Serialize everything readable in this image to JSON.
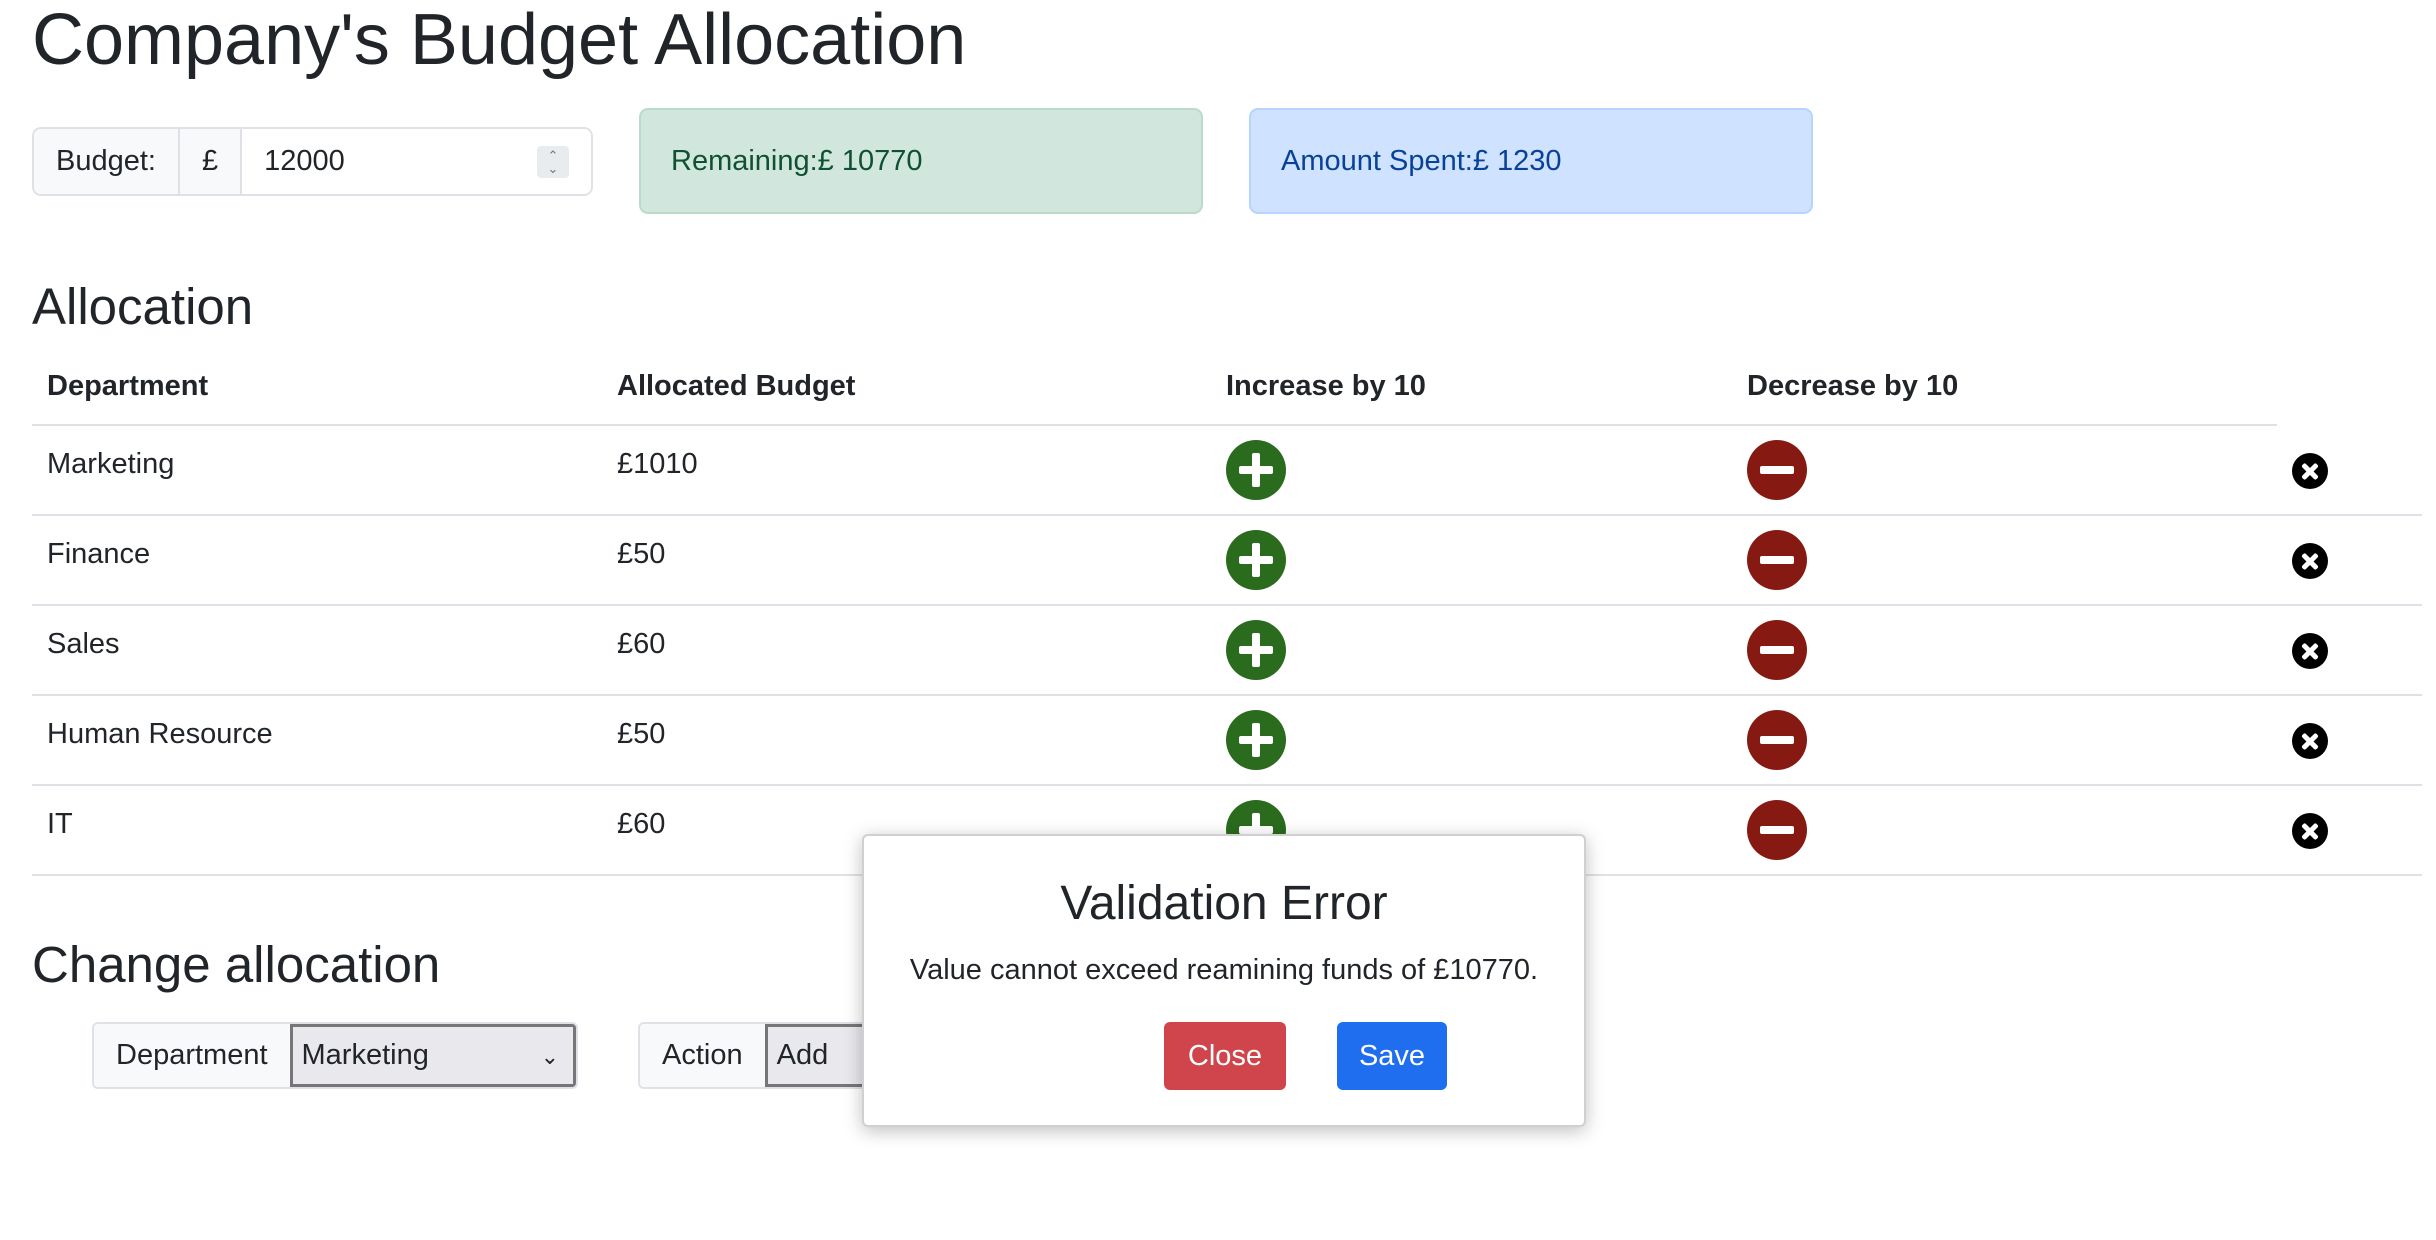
{
  "page": {
    "title": "Company's Budget Allocation"
  },
  "budget": {
    "label": "Budget:",
    "currency": "£",
    "value": "12000"
  },
  "remaining": {
    "text": "Remaining:£ 10770"
  },
  "spent": {
    "text": "Amount Spent:£ 1230"
  },
  "allocation": {
    "heading": "Allocation",
    "columns": [
      "Department",
      "Allocated Budget",
      "Increase by 10",
      "Decrease by 10"
    ],
    "rows": [
      {
        "department": "Marketing",
        "budget": "£1010"
      },
      {
        "department": "Finance",
        "budget": "£50"
      },
      {
        "department": "Sales",
        "budget": "£60"
      },
      {
        "department": "Human Resource",
        "budget": "£50"
      },
      {
        "department": "IT",
        "budget": "£60"
      }
    ]
  },
  "change": {
    "heading": "Change allocation",
    "department_label": "Department",
    "department_selected": "Marketing",
    "action_label": "Action",
    "action_selected": "Add"
  },
  "modal": {
    "title": "Validation Error",
    "message": "Value cannot exceed reamining funds of £10770.",
    "close_label": "Close",
    "save_label": "Save"
  },
  "colors": {
    "increase": "#2a6b1d",
    "decrease": "#861a12",
    "close": "#d0454c",
    "save": "#1f6ef0"
  }
}
